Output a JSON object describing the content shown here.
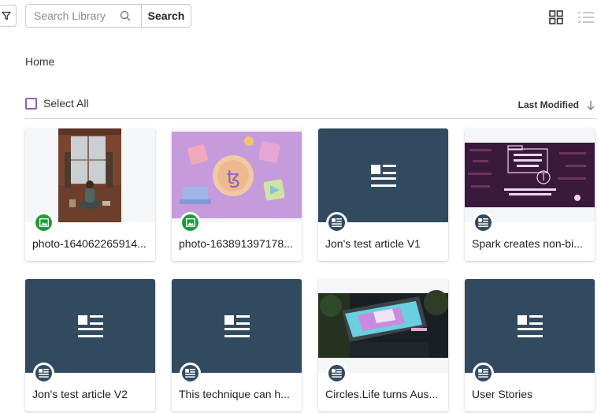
{
  "toolbar": {
    "search_placeholder": "Search Library",
    "search_button": "Search"
  },
  "breadcrumb": "Home",
  "selection": {
    "select_all_label": "Select All"
  },
  "sort": {
    "label": "Last Modified",
    "direction": "descending"
  },
  "colors": {
    "article_tile": "#324a60",
    "photo_badge": "#1f9b3a",
    "checkbox_accent": "#8a63c2"
  },
  "items": [
    {
      "title": "photo-164062265914...",
      "type": "photo",
      "icon": "image-icon"
    },
    {
      "title": "photo-163891397178...",
      "type": "photo",
      "icon": "image-icon"
    },
    {
      "title": "Jon's test article V1",
      "type": "article",
      "icon": "article-icon"
    },
    {
      "title": "Spark creates non-bi...",
      "type": "article",
      "icon": "article-icon"
    },
    {
      "title": "Jon's test article V2",
      "type": "article",
      "icon": "article-icon"
    },
    {
      "title": "This technique can h...",
      "type": "article",
      "icon": "article-icon"
    },
    {
      "title": "Circles.Life turns Aus...",
      "type": "article",
      "icon": "article-icon"
    },
    {
      "title": "User Stories",
      "type": "article",
      "icon": "article-icon"
    }
  ]
}
